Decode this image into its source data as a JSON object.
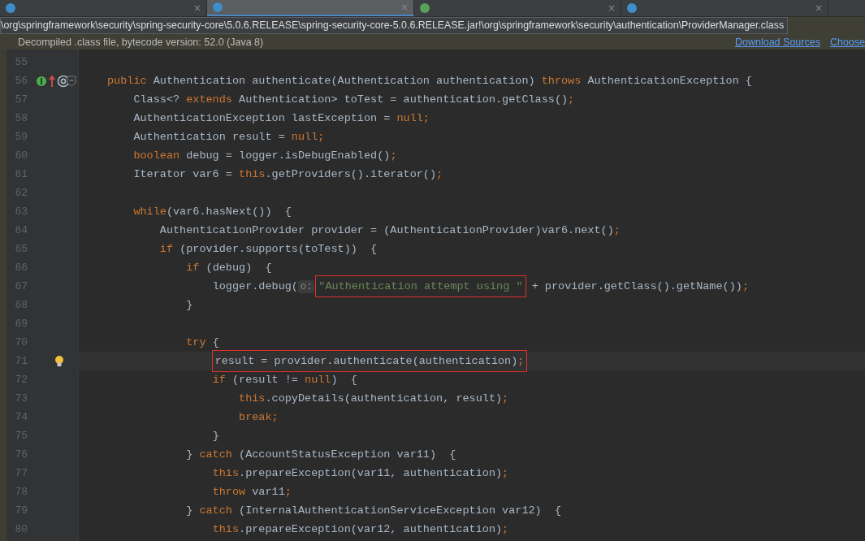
{
  "tabs": [
    {
      "kind": "class",
      "selected": false,
      "close": "×"
    },
    {
      "kind": "class",
      "selected": true,
      "close": "×"
    },
    {
      "kind": "interface",
      "selected": false,
      "close": "×"
    },
    {
      "kind": "class",
      "selected": false,
      "close": "×"
    }
  ],
  "tooltip": "\\org\\springframework\\security\\spring-security-core\\5.0.6.RELEASE\\spring-security-core-5.0.6.RELEASE.jar!\\org\\springframework\\security\\authentication\\ProviderManager.class",
  "banner": {
    "text": "Decompiled .class file, bytecode version: 52.0 (Java 8)",
    "links": [
      "Download Sources",
      "Choose"
    ]
  },
  "lines": [
    {
      "number": "55"
    },
    {
      "number": "56",
      "markers": [
        {
          "kind": "implements"
        },
        {
          "kind": "override"
        },
        {
          "kind": "annotation"
        }
      ],
      "fold": true,
      "tokens": [
        {
          "kind": "kw",
          "text": "public "
        },
        {
          "kind": "plain",
          "text": "Authentication authenticate(Authentication authentication) "
        },
        {
          "kind": "kw",
          "text": "throws "
        },
        {
          "kind": "plain",
          "text": "AuthenticationException {"
        }
      ]
    },
    {
      "number": "57",
      "tokens": [
        {
          "kind": "plain",
          "text": "    Class<? "
        },
        {
          "kind": "kw",
          "text": "extends "
        },
        {
          "kind": "plain",
          "text": "Authentication> toTest = authentication.getClass()"
        },
        {
          "kind": "kw",
          "text": ";"
        }
      ]
    },
    {
      "number": "58",
      "tokens": [
        {
          "kind": "plain",
          "text": "    AuthenticationException lastException = "
        },
        {
          "kind": "kw",
          "text": "null;"
        }
      ]
    },
    {
      "number": "59",
      "tokens": [
        {
          "kind": "plain",
          "text": "    Authentication result = "
        },
        {
          "kind": "kw",
          "text": "null;"
        }
      ]
    },
    {
      "number": "60",
      "tokens": [
        {
          "kind": "kw",
          "text": "    boolean "
        },
        {
          "kind": "plain",
          "text": "debug = logger.isDebugEnabled()"
        },
        {
          "kind": "kw",
          "text": ";"
        }
      ]
    },
    {
      "number": "61",
      "tokens": [
        {
          "kind": "plain",
          "text": "    Iterator var6 = "
        },
        {
          "kind": "kw",
          "text": "this"
        },
        {
          "kind": "plain",
          "text": ".getProviders().iterator()"
        },
        {
          "kind": "kw",
          "text": ";"
        }
      ]
    },
    {
      "number": "62"
    },
    {
      "number": "63",
      "tokens": [
        {
          "kind": "kw",
          "text": "    while"
        },
        {
          "kind": "plain",
          "text": "(var6.hasNext())  {"
        }
      ]
    },
    {
      "number": "64",
      "tokens": [
        {
          "kind": "plain",
          "text": "        AuthenticationProvider provider = (AuthenticationProvider)var6.next()"
        },
        {
          "kind": "kw",
          "text": ";"
        }
      ]
    },
    {
      "number": "65",
      "tokens": [
        {
          "kind": "kw",
          "text": "        if "
        },
        {
          "kind": "plain",
          "text": "(provider.supports(toTest))  {"
        }
      ]
    },
    {
      "number": "66",
      "tokens": [
        {
          "kind": "kw",
          "text": "            if "
        },
        {
          "kind": "plain",
          "text": "(debug)  {"
        }
      ]
    },
    {
      "number": "67",
      "tokens": [
        {
          "kind": "plain",
          "text": "                logger.debug("
        },
        {
          "kind": "hint",
          "text": "o:"
        },
        {
          "kind": "box",
          "tokens": [
            {
              "kind": "str",
              "text": "\"Authentication attempt using \""
            }
          ]
        },
        {
          "kind": "plain",
          "text": " + provider.getClass().getName())"
        },
        {
          "kind": "kw",
          "text": ";"
        }
      ]
    },
    {
      "number": "68",
      "tokens": [
        {
          "kind": "plain",
          "text": "            }"
        }
      ]
    },
    {
      "number": "69"
    },
    {
      "number": "70",
      "tokens": [
        {
          "kind": "kw",
          "text": "            try "
        },
        {
          "kind": "plain",
          "text": "{"
        }
      ]
    },
    {
      "number": "71",
      "current": true,
      "markers": [
        {
          "kind": "bulb"
        }
      ],
      "tokens": [
        {
          "kind": "box",
          "tokens": [
            {
              "kind": "plain",
              "text": "                result = provider.authenticate(authentication)"
            },
            {
              "kind": "kw",
              "text": ";"
            }
          ]
        }
      ]
    },
    {
      "number": "72",
      "tokens": [
        {
          "kind": "kw",
          "text": "                if "
        },
        {
          "kind": "plain",
          "text": "(result != "
        },
        {
          "kind": "kw",
          "text": "null"
        },
        {
          "kind": "plain",
          "text": ")  {"
        }
      ]
    },
    {
      "number": "73",
      "tokens": [
        {
          "kind": "kw",
          "text": "                    this"
        },
        {
          "kind": "plain",
          "text": ".copyDetails(authentication, result)"
        },
        {
          "kind": "kw",
          "text": ";"
        }
      ]
    },
    {
      "number": "74",
      "tokens": [
        {
          "kind": "kw",
          "text": "                    break;"
        }
      ]
    },
    {
      "number": "75",
      "tokens": [
        {
          "kind": "plain",
          "text": "                }"
        }
      ]
    },
    {
      "number": "76",
      "tokens": [
        {
          "kind": "plain",
          "text": "            } "
        },
        {
          "kind": "kw",
          "text": "catch "
        },
        {
          "kind": "plain",
          "text": "(AccountStatusException var11)  {"
        }
      ]
    },
    {
      "number": "77",
      "tokens": [
        {
          "kind": "kw",
          "text": "                this"
        },
        {
          "kind": "plain",
          "text": ".prepareException(var11, authentication)"
        },
        {
          "kind": "kw",
          "text": ";"
        }
      ]
    },
    {
      "number": "78",
      "tokens": [
        {
          "kind": "kw",
          "text": "                throw "
        },
        {
          "kind": "plain",
          "text": "var11"
        },
        {
          "kind": "kw",
          "text": ";"
        }
      ]
    },
    {
      "number": "79",
      "tokens": [
        {
          "kind": "plain",
          "text": "            } "
        },
        {
          "kind": "kw",
          "text": "catch "
        },
        {
          "kind": "plain",
          "text": "(InternalAuthenticationServiceException var12)  {"
        }
      ]
    },
    {
      "number": "80",
      "tokens": [
        {
          "kind": "kw",
          "text": "                this"
        },
        {
          "kind": "plain",
          "text": ".prepareException(var12, authentication)"
        },
        {
          "kind": "kw",
          "text": ";"
        }
      ]
    }
  ]
}
